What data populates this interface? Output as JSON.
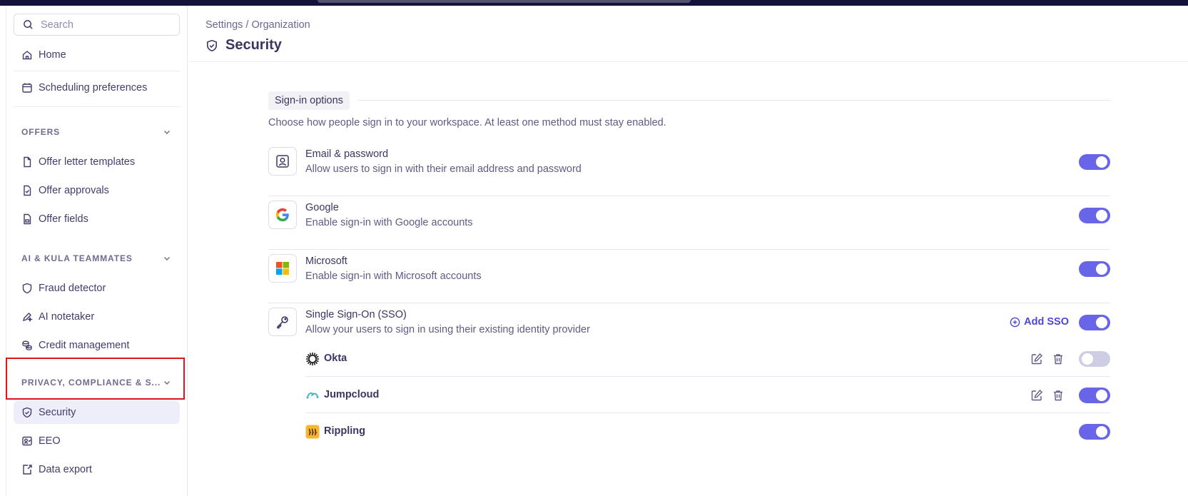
{
  "search": {
    "placeholder": "Search"
  },
  "sidebar": {
    "home": "Home",
    "scheduling": "Scheduling preferences",
    "offers_header": "OFFERS",
    "offers": [
      "Offer letter templates",
      "Offer approvals",
      "Offer fields"
    ],
    "ai_header": "AI & KULA TEAMMATES",
    "ai": [
      "Fraud detector",
      "AI notetaker",
      "Credit management"
    ],
    "privacy_header": "PRIVACY, COMPLIANCE & S...",
    "privacy": [
      "Security",
      "EEO",
      "Data export"
    ]
  },
  "header": {
    "breadcrumb": "Settings / Organization",
    "title": "Security"
  },
  "signin": {
    "tag": "Sign-in options",
    "description": "Choose how people sign in to your workspace. At least one method must stay enabled.",
    "methods": [
      {
        "title": "Email & password",
        "subtitle": "Allow users to sign in with their email address and password",
        "enabled": true,
        "icon": "user-card-icon"
      },
      {
        "title": "Google",
        "subtitle": "Enable sign-in with Google accounts",
        "enabled": true,
        "icon": "google-icon"
      },
      {
        "title": "Microsoft",
        "subtitle": "Enable sign-in with Microsoft accounts",
        "enabled": true,
        "icon": "microsoft-icon"
      },
      {
        "title": "Single Sign-On (SSO)",
        "subtitle": "Allow your users to sign in using their existing identity provider",
        "enabled": true,
        "icon": "key-icon"
      }
    ],
    "add_sso": "Add SSO",
    "providers": [
      {
        "name": "Okta",
        "enabled": false,
        "icon": "okta-icon"
      },
      {
        "name": "Jumpcloud",
        "enabled": true,
        "icon": "jumpcloud-icon"
      },
      {
        "name": "Rippling",
        "enabled": true,
        "icon": "rippling-icon"
      }
    ]
  },
  "colors": {
    "accent": "#6865e8",
    "link": "#4b47d6",
    "text": "#3b3561",
    "highlight": "#e0151c"
  }
}
